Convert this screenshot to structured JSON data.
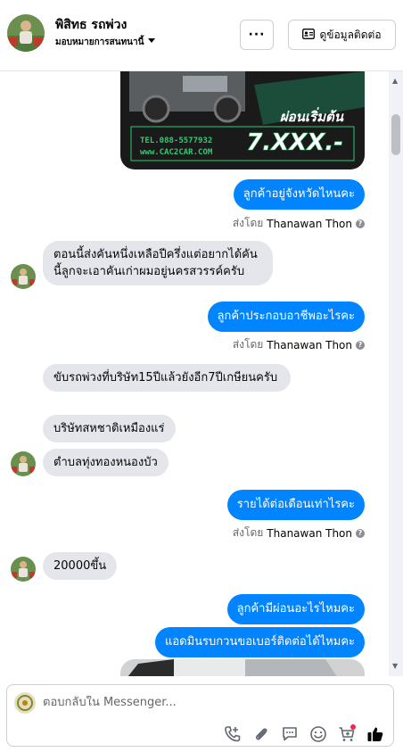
{
  "header": {
    "name": "พิสิทธ รถพ่วง",
    "assign_label": "มอบหมายการสนทนานี้",
    "more_label": "···",
    "contact_label": "ดูข้อมูลติดต่อ"
  },
  "promo_image": {
    "price_line1": "ผ่อนเริ่มต้น",
    "price_line2": "7.XXX.-",
    "phone": "TEL.088-5577932",
    "web": "www.CAC2CAR.COM"
  },
  "messages": [
    {
      "side": "out",
      "text": "ลูกค้าอยู่จังหวัดไหนคะ"
    },
    {
      "side": "in",
      "text": "ตอนนี้ส่งคันหนึ่งเหลือปีครึ่งแต่อยากได้คันนี้ลูกจะเอาคันเก่าผมอยู่นครสวรรค์ครับ"
    },
    {
      "side": "out",
      "text": "ลูกค้าประกอบอาชีพอะไรคะ"
    },
    {
      "side": "in",
      "text": "ขับรถพ่วงที่บริษัท15ปีแล้วยังอีก7ปีเกษียนครับ"
    },
    {
      "side": "in",
      "text": "บริษัทสหชาติเหมืองแร่"
    },
    {
      "side": "in",
      "text": "ตำบลทุ่งทองหนองบัว"
    },
    {
      "side": "out",
      "text": "รายได้ต่อเดือนเท่าไรคะ"
    },
    {
      "side": "in",
      "text": "20000ขึ้น"
    },
    {
      "side": "out",
      "text": "ลูกค้ามีผ่อนอะไรไหมคะ"
    },
    {
      "side": "out",
      "text": "แอดมินรบกวนขอเบอร์ติดต่อได้ไหมคะ"
    }
  ],
  "sent_by": {
    "prefix": "ส่งโดย",
    "agent": "Thanawan Thon",
    "info_icon": "?"
  },
  "composer": {
    "placeholder": "ตอบกลับใน Messenger..."
  },
  "colors": {
    "outgoing_bubble": "#0084ff",
    "incoming_bubble": "#e4e6eb",
    "icon": "#606770"
  },
  "icons": {
    "more": "ellipsis-icon",
    "contact": "contact-card-icon",
    "call": "phone-add-icon",
    "attach": "paperclip-icon",
    "saved_reply": "chat-bubble-icon",
    "emoji": "smiley-icon",
    "cart": "cart-icon",
    "like": "thumbs-up-icon"
  }
}
